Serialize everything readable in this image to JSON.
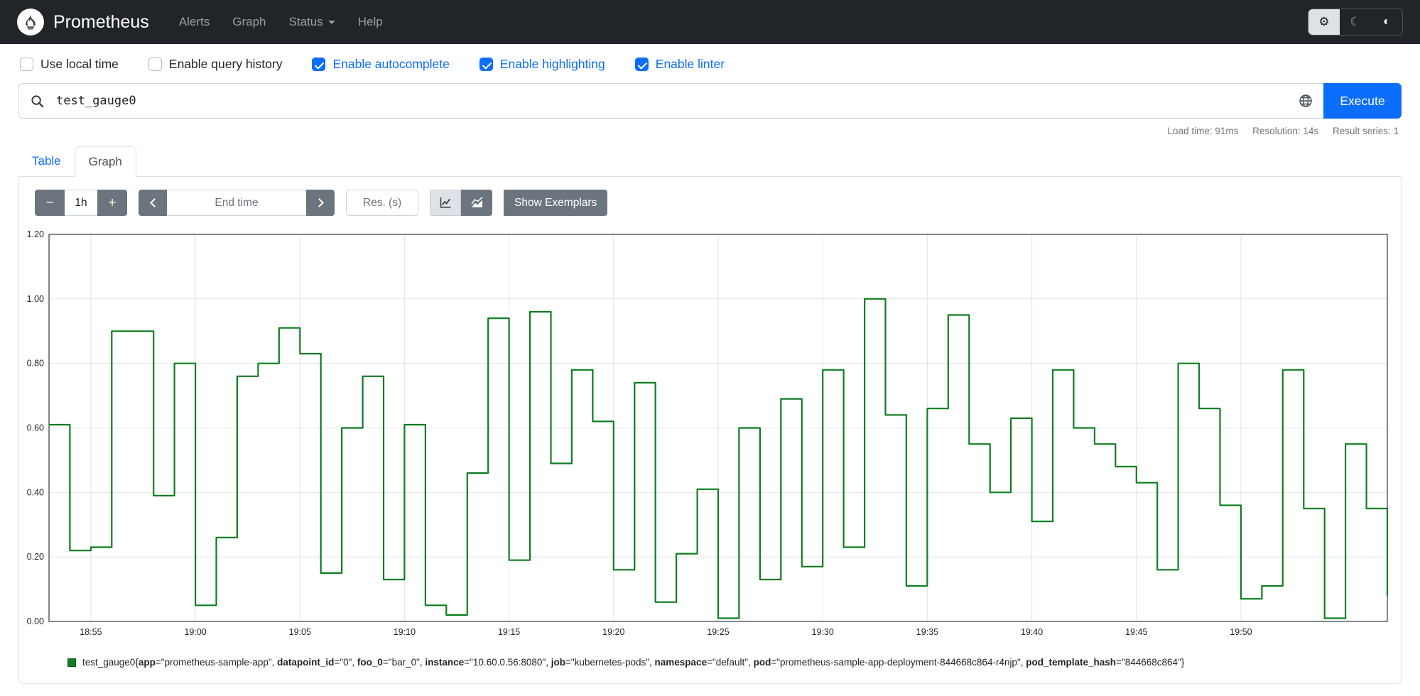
{
  "colors": {
    "accent": "#0d6efd",
    "navbar_bg": "#212529",
    "series_green": "#0e7d20"
  },
  "icons": {
    "gear": "⚙",
    "moon": "☾",
    "contrast": "◐",
    "minus": "−",
    "plus": "+"
  },
  "navbar": {
    "brand": "Prometheus",
    "links": [
      {
        "label": "Alerts"
      },
      {
        "label": "Graph"
      },
      {
        "label": "Status",
        "has_dropdown": true
      },
      {
        "label": "Help"
      }
    ]
  },
  "options_bar": {
    "checkboxes": [
      {
        "label": "Use local time",
        "checked": false
      },
      {
        "label": "Enable query history",
        "checked": false
      },
      {
        "label": "Enable autocomplete",
        "checked": true
      },
      {
        "label": "Enable highlighting",
        "checked": true
      },
      {
        "label": "Enable linter",
        "checked": true
      }
    ]
  },
  "query_bar": {
    "expression": "test_gauge0",
    "execute_label": "Execute"
  },
  "stats_bar": {
    "load_time": "Load time: 91ms",
    "resolution": "Resolution: 14s",
    "result_series": "Result series: 1"
  },
  "tabs": [
    {
      "label": "Table",
      "active": false
    },
    {
      "label": "Graph",
      "active": true
    }
  ],
  "graph_controls": {
    "range": "1h",
    "end_time_placeholder": "End time",
    "resolution_placeholder": "Res. (s)",
    "show_exemplars_label": "Show Exemplars"
  },
  "chart_data": {
    "type": "line",
    "step": true,
    "grid": true,
    "title": "",
    "ylim": [
      0,
      1.2
    ],
    "y_ticks": [
      "0.00",
      "0.20",
      "0.40",
      "0.60",
      "0.80",
      "1.00",
      "1.20"
    ],
    "x_tick_labels": [
      "18:55",
      "19:00",
      "19:05",
      "19:10",
      "19:15",
      "19:20",
      "19:25",
      "19:30",
      "19:35",
      "19:40",
      "19:45",
      "19:50"
    ],
    "x_tick_offsets_min": [
      2,
      7,
      12,
      17,
      22,
      27,
      32,
      37,
      42,
      47,
      52,
      57
    ],
    "x_range_min": 64,
    "series": [
      {
        "name": "test_gauge0",
        "color": "#0e7d20",
        "sample_interval_min": 1,
        "values": [
          0.61,
          0.22,
          0.23,
          0.9,
          0.9,
          0.39,
          0.8,
          0.05,
          0.26,
          0.76,
          0.8,
          0.91,
          0.83,
          0.15,
          0.6,
          0.76,
          0.13,
          0.61,
          0.05,
          0.02,
          0.46,
          0.94,
          0.19,
          0.96,
          0.49,
          0.78,
          0.62,
          0.16,
          0.74,
          0.06,
          0.21,
          0.41,
          0.01,
          0.6,
          0.13,
          0.69,
          0.17,
          0.78,
          0.23,
          1.0,
          0.64,
          0.11,
          0.66,
          0.95,
          0.55,
          0.4,
          0.63,
          0.31,
          0.78,
          0.6,
          0.55,
          0.48,
          0.43,
          0.16,
          0.8,
          0.66,
          0.36,
          0.07,
          0.11,
          0.78,
          0.35,
          0.01,
          0.55,
          0.35,
          0.08
        ]
      }
    ]
  },
  "legend": {
    "metric": "test_gauge0",
    "labels": [
      {
        "name": "app",
        "value": "prometheus-sample-app"
      },
      {
        "name": "datapoint_id",
        "value": "0"
      },
      {
        "name": "foo_0",
        "value": "bar_0"
      },
      {
        "name": "instance",
        "value": "10.60.0.56:8080"
      },
      {
        "name": "job",
        "value": "kubernetes-pods"
      },
      {
        "name": "namespace",
        "value": "default"
      },
      {
        "name": "pod",
        "value": "prometheus-sample-app-deployment-844668c864-r4njp"
      },
      {
        "name": "pod_template_hash",
        "value": "844668c864"
      }
    ]
  }
}
